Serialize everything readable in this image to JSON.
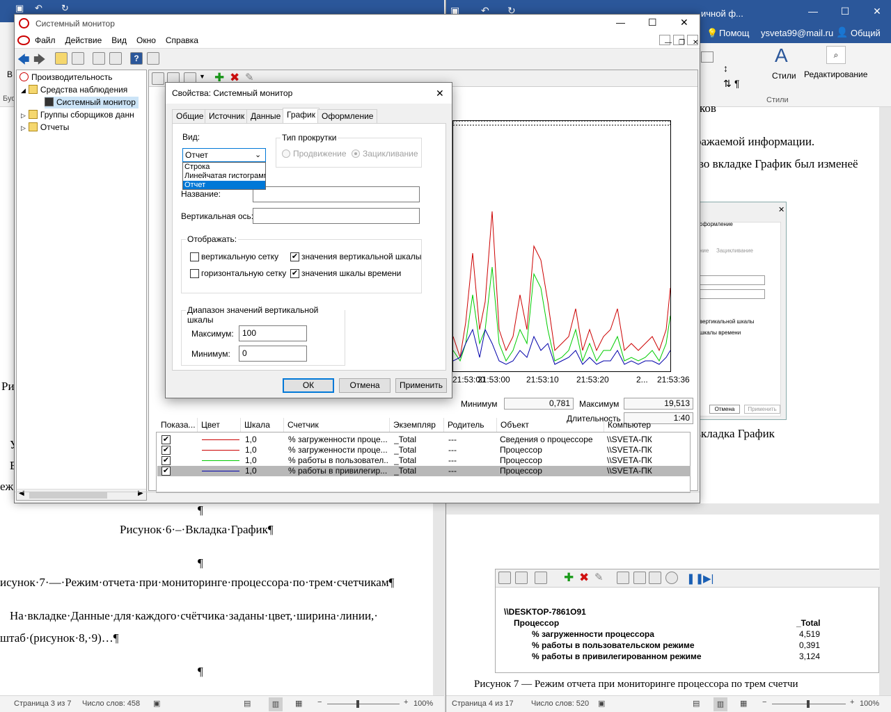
{
  "left_word": {
    "body_lines": [
      "Рисунок·6·–·Вкладка·График¶",
      "¶",
      "исунок·7·—·Режим·отчета·при·мониторинге·процессора·по·трем·счетчикам¶",
      "На·вкладке·Данные·для·каждого·счётчика·заданы·цвет,·ширина·линии,·",
      "штаб·(рисунок·8,·9)…¶",
      "¶",
      "¶"
    ],
    "side_fragments": [
      "В",
      "Буф",
      "Ри",
      "У",
      "Е",
      "еж"
    ],
    "status": {
      "page": "Страница 3 из 7",
      "words": "Число слов: 458",
      "zoom": "100%"
    }
  },
  "right_word": {
    "title_fragment": "ичной ф...",
    "help": "Помощ",
    "account": "ysveta99@mail.ru",
    "share": "Общий",
    "ribbon": {
      "styles": "Стили",
      "editing": "Редактирование",
      "group_styles": "Стили"
    },
    "body_lines": [
      "ков",
      "ражаемой информации.",
      "во вкладке График был изменеё",
      "вкладка График"
    ],
    "thumb": {
      "tab": "оформление",
      "radio": "Зацикливание",
      "radio2": "ние",
      "cb1": "вертикальной шкалы",
      "cb2": "шкалы времени",
      "btn_cancel": "Отмена",
      "btn_apply": "Применить"
    },
    "report": {
      "computer": "\\\\DESKTOP-7861O91",
      "object": "Процессор",
      "instance": "_Total",
      "rows": [
        {
          "name": "% загруженности процессора",
          "value": "4,519"
        },
        {
          "name": "% работы в пользовательском режиме",
          "value": "0,391"
        },
        {
          "name": "% работы в привилегированном режиме",
          "value": "3,124"
        }
      ]
    },
    "caption_fragment": "Рисунок 7 — Режим отчета при мониторинге процессора по трем счетчи",
    "status": {
      "page": "Страница 4 из 17",
      "words": "Число слов: 520",
      "zoom": "100%"
    }
  },
  "monitor": {
    "title": "Системный монитор",
    "menu": [
      "Файл",
      "Действие",
      "Вид",
      "Окно",
      "Справка"
    ],
    "tree": [
      "Производительность",
      "Средства наблюдения",
      "Системный монитор",
      "Группы сборщиков данн",
      "Отчеты"
    ],
    "time_labels": [
      "21:53:00",
      "21:53:10",
      "21:53:20",
      "2...",
      "21:53:36"
    ],
    "stats": {
      "min_label": "Минимум",
      "min_value": "0,781",
      "max_label": "Максимум",
      "max_value": "19,513",
      "dur_label": "Длительность",
      "dur_value": "1:40"
    },
    "columns": [
      "Показа...",
      "Цвет",
      "Шкала",
      "Счетчик",
      "Экземпляр",
      "Родитель",
      "Объект",
      "Компьютер"
    ],
    "counters": [
      {
        "color": "#cc0000",
        "scale": "1,0",
        "counter": "% загруженности проце...",
        "instance": "_Total",
        "parent": "---",
        "object": "Сведения о процессоре",
        "computer": "\\\\SVETA-ПК"
      },
      {
        "color": "#cc0000",
        "scale": "1,0",
        "counter": "% загруженности проце...",
        "instance": "_Total",
        "parent": "---",
        "object": "Процессор",
        "computer": "\\\\SVETA-ПК"
      },
      {
        "color": "#00cc00",
        "scale": "1,0",
        "counter": "% работы в пользовател...",
        "instance": "_Total",
        "parent": "---",
        "object": "Процессор",
        "computer": "\\\\SVETA-ПК"
      },
      {
        "color": "#0000aa",
        "scale": "1,0",
        "counter": "% работы в привилегир...",
        "instance": "_Total",
        "parent": "---",
        "object": "Процессор",
        "computer": "\\\\SVETA-ПК"
      }
    ]
  },
  "dialog": {
    "title": "Свойства: Системный монитор",
    "tabs": [
      "Общие",
      "Источник",
      "Данные",
      "График",
      "Оформление"
    ],
    "view_label": "Вид:",
    "view_selected": "Отчет",
    "view_options": [
      "Строка",
      "Линейчатая гистограмма",
      "Отчет"
    ],
    "scroll_group": "Тип прокрутки",
    "scroll_opt1": "Продвижение",
    "scroll_opt2": "Зацикливание",
    "name_label": "Название:",
    "vaxis_label": "Вертикальная ось:",
    "show_group": "Отображать:",
    "cb_vgrid": "вертикальную сетку",
    "cb_hgrid": "горизонтальную сетку",
    "cb_vscale": "значения вертикальной шкалы",
    "cb_tscale": "значения шкалы времени",
    "range_group": "Диапазон значений вертикальной шкалы",
    "max_label": "Максимум:",
    "max_value": "100",
    "min_label": "Минимум:",
    "min_value": "0",
    "ok": "ОК",
    "cancel": "Отмена",
    "apply": "Применить"
  }
}
